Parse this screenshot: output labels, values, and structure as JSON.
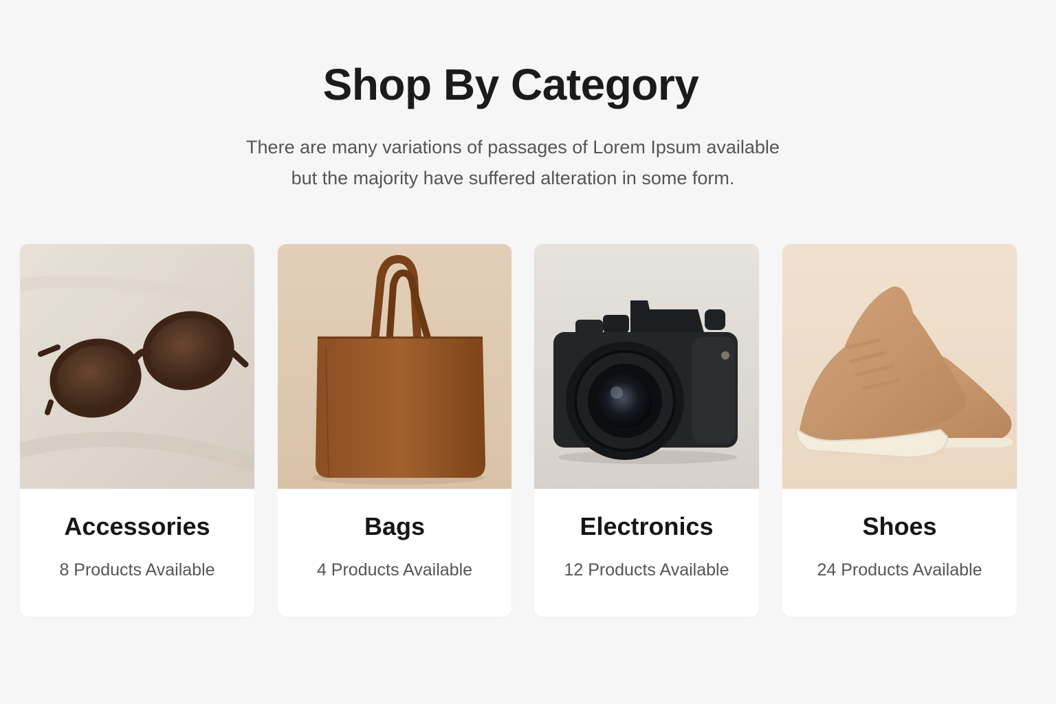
{
  "section": {
    "title": "Shop By Category",
    "subtitle_line1": "There are many variations of passages of Lorem Ipsum available",
    "subtitle_line2": "but the majority have suffered alteration in some form."
  },
  "categories": [
    {
      "name": "Accessories",
      "count": "8 Products Available",
      "icon": "sunglasses-image"
    },
    {
      "name": "Bags",
      "count": "4 Products Available",
      "icon": "tote-bag-image"
    },
    {
      "name": "Electronics",
      "count": "12 Products Available",
      "icon": "camera-image"
    },
    {
      "name": "Shoes",
      "count": "24 Products Available",
      "icon": "sneakers-image"
    }
  ],
  "colors": {
    "background": "#f6f6f6",
    "card": "#ffffff",
    "title": "#1b1b1b",
    "muted_text": "#555555"
  }
}
